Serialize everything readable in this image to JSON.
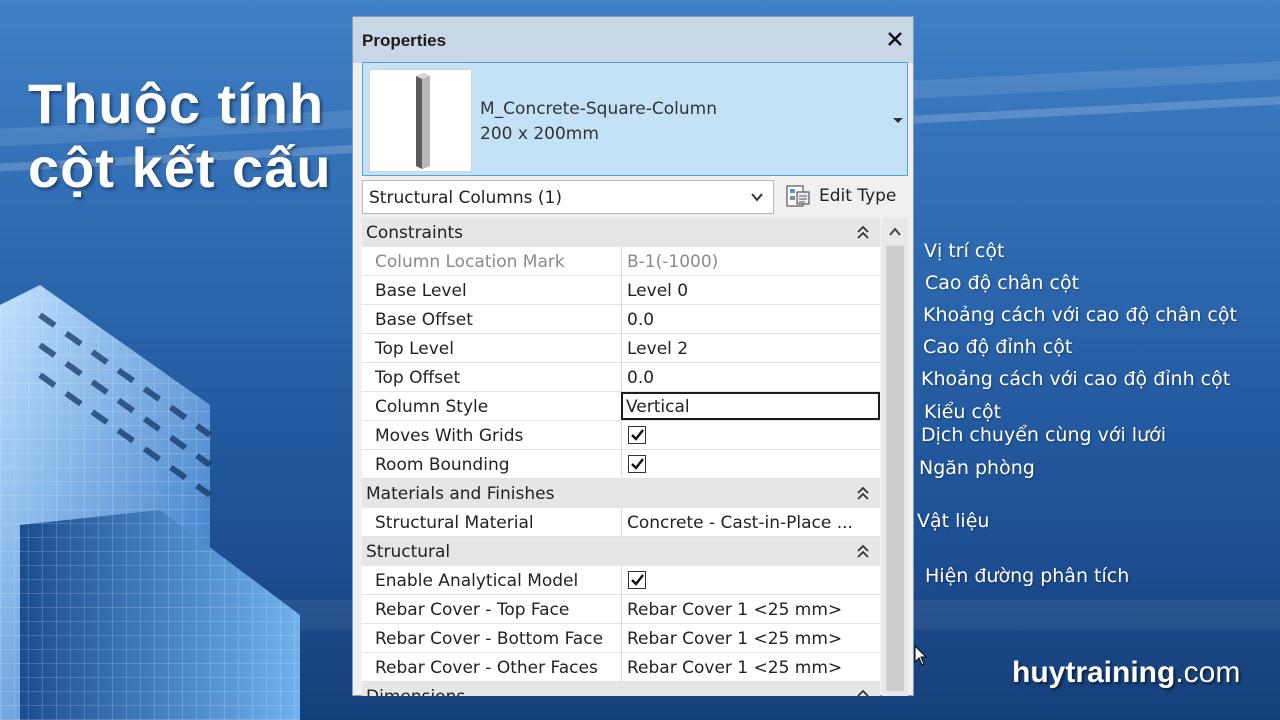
{
  "slide": {
    "title_line1": "Thuộc tính",
    "title_line2": "cột kết cấu",
    "brand_name": "huytraining",
    "brand_suffix": ".com"
  },
  "properties": {
    "window_title": "Properties",
    "type_name": "M_Concrete-Square-Column",
    "type_size": "200 x 200mm",
    "category_selector": "Structural Columns (1)",
    "edit_type_label": "Edit Type",
    "sections": [
      {
        "label": "Constraints",
        "rows": [
          {
            "name": "Column Location Mark",
            "value": "B-1(-1000)"
          },
          {
            "name": "Base Level",
            "value": "Level 0"
          },
          {
            "name": "Base Offset",
            "value": "0.0"
          },
          {
            "name": "Top Level",
            "value": "Level 2"
          },
          {
            "name": "Top Offset",
            "value": "0.0"
          },
          {
            "name": "Column Style",
            "value": "Vertical"
          },
          {
            "name": "Moves With Grids",
            "checked": true
          },
          {
            "name": "Room Bounding",
            "checked": true
          }
        ]
      },
      {
        "label": "Materials and Finishes",
        "rows": [
          {
            "name": "Structural Material",
            "value": "Concrete - Cast-in-Place ..."
          }
        ]
      },
      {
        "label": "Structural",
        "rows": [
          {
            "name": "Enable Analytical Model",
            "checked": true
          },
          {
            "name": "Rebar Cover - Top Face",
            "value": "Rebar Cover 1 <25 mm>"
          },
          {
            "name": "Rebar Cover - Bottom Face",
            "value": "Rebar Cover 1 <25 mm>"
          },
          {
            "name": "Rebar Cover - Other Faces",
            "value": "Rebar Cover 1 <25 mm>"
          }
        ]
      },
      {
        "label": "Dimensions",
        "rows": []
      }
    ]
  },
  "annotations": [
    "Vị trí cột",
    "Cao độ chân cột",
    "Khoảng cách với cao độ chân cột",
    "Cao độ đỉnh cột",
    "Khoảng cách với cao độ đỉnh cột",
    "Kiểu cột",
    "Dịch chuyển cùng với lưới",
    "Ngăn phòng",
    "Vật liệu",
    "Hiện đường phân tích"
  ]
}
